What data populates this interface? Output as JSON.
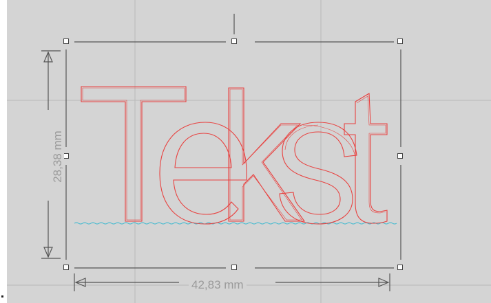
{
  "canvas": {
    "background": "#d4d4d4",
    "grid_color": "#b9b9b9",
    "text_outline_color": "#e8413f",
    "baseline_color": "#35b7cf"
  },
  "design_text": "Tekst",
  "dimensions": {
    "width_label": "42,83 mm",
    "height_label": "28,38 mm"
  },
  "selection": {
    "handles": [
      "top-left",
      "top-center",
      "top-right",
      "middle-left",
      "middle-right",
      "bottom-left",
      "bottom-center",
      "bottom-right"
    ]
  }
}
